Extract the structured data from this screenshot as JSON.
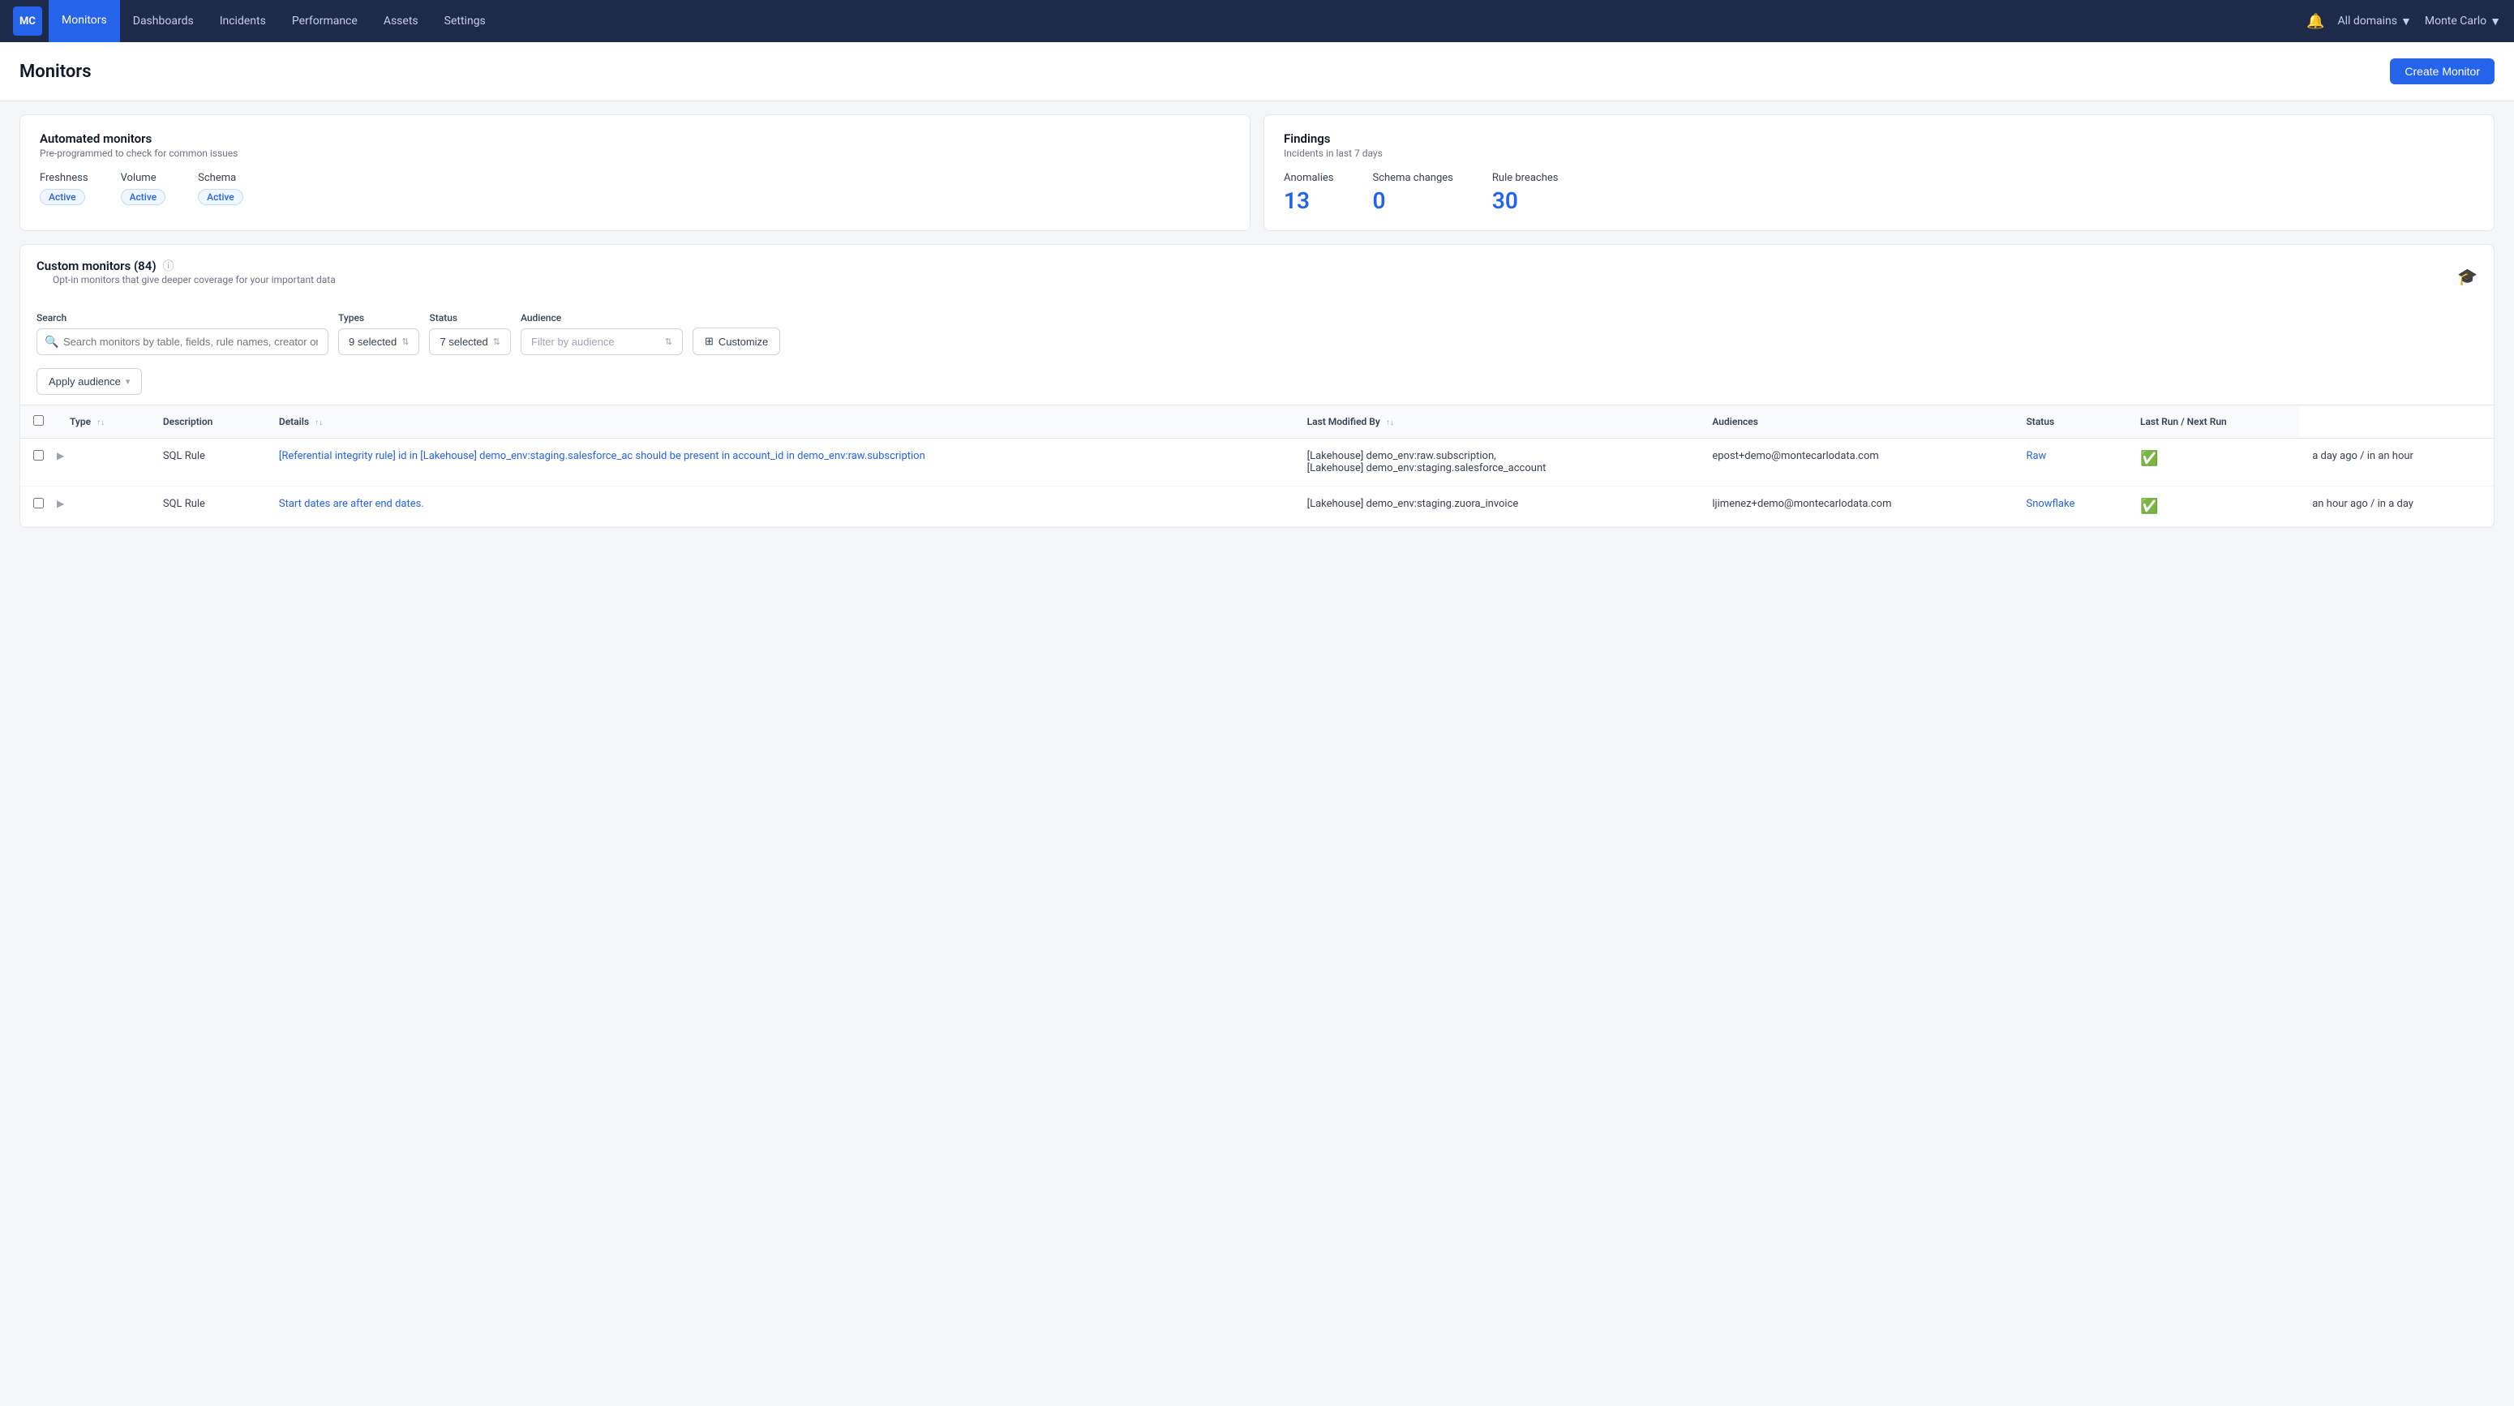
{
  "nav": {
    "logo": "MC",
    "items": [
      {
        "label": "Monitors",
        "active": true
      },
      {
        "label": "Dashboards",
        "active": false
      },
      {
        "label": "Incidents",
        "active": false
      },
      {
        "label": "Performance",
        "active": false
      },
      {
        "label": "Assets",
        "active": false
      },
      {
        "label": "Settings",
        "active": false
      }
    ],
    "domain_label": "All domains",
    "user_label": "Monte Carlo"
  },
  "page": {
    "title": "Monitors",
    "create_button": "Create Monitor"
  },
  "automated_card": {
    "title": "Automated monitors",
    "subtitle": "Pre-programmed to check for common issues",
    "monitors": [
      {
        "label": "Freshness",
        "status": "Active"
      },
      {
        "label": "Volume",
        "status": "Active"
      },
      {
        "label": "Schema",
        "status": "Active"
      }
    ]
  },
  "findings_card": {
    "title": "Findings",
    "subtitle": "Incidents in last 7 days",
    "items": [
      {
        "label": "Anomalies",
        "value": "13"
      },
      {
        "label": "Schema changes",
        "value": "0"
      },
      {
        "label": "Rule breaches",
        "value": "30"
      }
    ]
  },
  "custom_section": {
    "title": "Custom monitors (84)",
    "description": "Opt-in monitors that give deeper coverage for your important data"
  },
  "filters": {
    "search_label": "Search",
    "search_placeholder": "Search monitors by table, fields, rule names, creator or namespace",
    "types_label": "Types",
    "types_value": "9 selected",
    "status_label": "Status",
    "status_value": "7 selected",
    "audience_label": "Audience",
    "audience_placeholder": "Filter by audience",
    "customize_label": "Customize",
    "apply_audience_label": "Apply audience"
  },
  "table": {
    "columns": [
      {
        "label": "Type",
        "sortable": true
      },
      {
        "label": "Description",
        "sortable": false
      },
      {
        "label": "Details",
        "sortable": true
      },
      {
        "label": "Last Modified By",
        "sortable": true
      },
      {
        "label": "Audiences",
        "sortable": false
      },
      {
        "label": "Status",
        "sortable": false
      },
      {
        "label": "Last Run / Next Run",
        "sortable": false
      }
    ],
    "rows": [
      {
        "id": 1,
        "type": "SQL Rule",
        "description": "[Referential integrity rule] id in [Lakehouse] demo_env:staging.salesforce_ac should be present in account_id in demo_env:raw.subscription",
        "details_lines": [
          "[Lakehouse] demo_env:raw.subscription,",
          "[Lakehouse] demo_env:staging.salesforce_account"
        ],
        "last_modified": "epost+demo@montecarlodata.com",
        "audience": "Raw",
        "audience_color": "#2563eb",
        "status_icon": "check-circle",
        "last_run": "a day ago / in an hour"
      },
      {
        "id": 2,
        "type": "SQL Rule",
        "description": "Start dates are after end dates.",
        "details_lines": [
          "[Lakehouse] demo_env:staging.zuora_invoice"
        ],
        "last_modified": "ljimenez+demo@montecarlodata.com",
        "audience": "Snowflake",
        "audience_color": "#2563eb",
        "status_icon": "check-circle",
        "last_run": "an hour ago / in a day"
      }
    ]
  }
}
